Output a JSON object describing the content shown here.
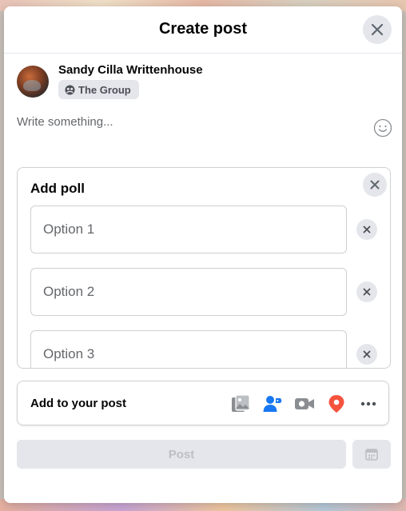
{
  "dialog": {
    "title": "Create post",
    "close_icon": "close-icon"
  },
  "author": {
    "name": "Sandy Cilla Writtenhouse",
    "audience_icon": "group-icon",
    "audience": "The Group"
  },
  "composer": {
    "placeholder": "Write something...",
    "emoji_icon": "smiley-icon"
  },
  "poll": {
    "title": "Add poll",
    "close_icon": "close-icon",
    "options": [
      {
        "placeholder": "Option 1",
        "remove_icon": "close-icon"
      },
      {
        "placeholder": "Option 2",
        "remove_icon": "close-icon"
      },
      {
        "placeholder": "Option 3",
        "remove_icon": "close-icon"
      }
    ]
  },
  "add_to_post": {
    "label": "Add to your post",
    "icons": [
      "photo-video-icon",
      "tag-people-icon",
      "live-video-icon",
      "check-in-icon",
      "more-icon"
    ],
    "colors": {
      "photo": "#45bd62",
      "tag": "#1877f2",
      "live": "#8a8d91",
      "checkin": "#f5533d"
    }
  },
  "actions": {
    "post_label": "Post",
    "schedule_icon": "calendar-icon"
  }
}
